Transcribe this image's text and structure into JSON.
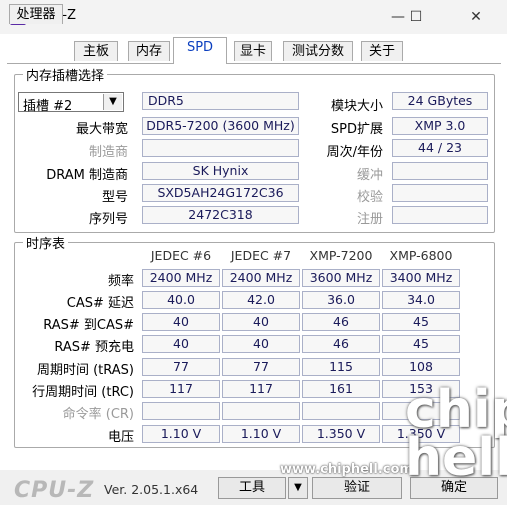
{
  "window": {
    "title": "CPU-Z",
    "minimize": "—",
    "maximize": "☐",
    "close": "✕"
  },
  "tabs": [
    "处理器",
    "主板",
    "内存",
    "SPD",
    "显卡",
    "测试分数",
    "关于"
  ],
  "slot_group": {
    "title": "内存插槽选择",
    "slot_select": "插槽 #2",
    "module_type": "DDR5",
    "labels": {
      "max_bandwidth": "最大带宽",
      "manufacturer": "制造商",
      "dram_manufacturer": "DRAM 制造商",
      "part_number": "型号",
      "serial_number": "序列号",
      "module_size": "模块大小",
      "spd_ext": "SPD扩展",
      "week_year": "周次/年份",
      "buffered": "缓冲",
      "correction": "校验",
      "registered": "注册"
    },
    "values": {
      "max_bandwidth": "DDR5-7200 (3600 MHz)",
      "manufacturer": "",
      "dram_manufacturer": "SK Hynix",
      "part_number": "SXD5AH24G172C36",
      "serial_number": "2472C318",
      "module_size": "24 GBytes",
      "spd_ext": "XMP 3.0",
      "week_year": "44 / 23",
      "buffered": "",
      "correction": "",
      "registered": ""
    }
  },
  "timings_group": {
    "title": "时序表",
    "columns": [
      "JEDEC #6",
      "JEDEC #7",
      "XMP-7200",
      "XMP-6800"
    ],
    "rows": [
      {
        "label": "频率",
        "values": [
          "2400 MHz",
          "2400 MHz",
          "3600 MHz",
          "3400 MHz"
        ],
        "gray": false
      },
      {
        "label": "CAS# 延迟",
        "values": [
          "40.0",
          "42.0",
          "36.0",
          "34.0"
        ],
        "gray": false
      },
      {
        "label": "RAS# 到CAS#",
        "values": [
          "40",
          "40",
          "46",
          "45"
        ],
        "gray": false
      },
      {
        "label": "RAS# 预充电",
        "values": [
          "40",
          "40",
          "46",
          "45"
        ],
        "gray": false
      },
      {
        "label": "周期时间 (tRAS)",
        "values": [
          "77",
          "77",
          "115",
          "108"
        ],
        "gray": false
      },
      {
        "label": "行周期时间 (tRC)",
        "values": [
          "117",
          "117",
          "161",
          "153"
        ],
        "gray": false
      },
      {
        "label": "命令率 (CR)",
        "values": [
          "",
          "",
          "",
          ""
        ],
        "gray": true
      },
      {
        "label": "电压",
        "values": [
          "1.10 V",
          "1.10 V",
          "1.350 V",
          "1.350 V"
        ],
        "gray": false
      }
    ]
  },
  "footer": {
    "brand": "CPU-Z",
    "version": "Ver. 2.05.1.x64",
    "tools": "工具",
    "validate": "验证",
    "ok": "确定"
  },
  "watermark": {
    "url": "www.chiphell.com",
    "logo": "chip hell"
  }
}
